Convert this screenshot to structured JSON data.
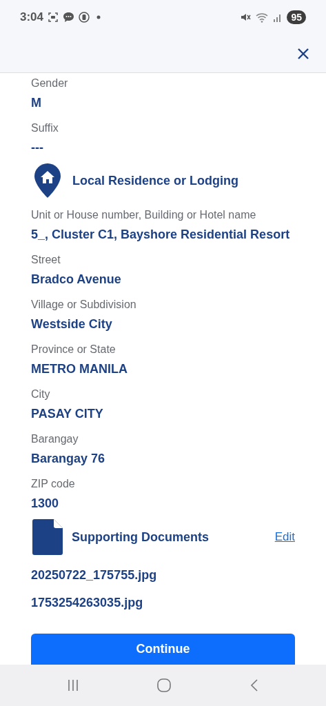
{
  "status_bar": {
    "time": "3:04",
    "battery": "95"
  },
  "personal_fields": [
    {
      "label": "Gender",
      "value": "M"
    },
    {
      "label": "Suffix",
      "value": "---"
    }
  ],
  "residence": {
    "title": "Local Residence or Lodging",
    "fields": [
      {
        "label": "Unit or House number, Building or Hotel name",
        "value": "5_, Cluster C1, Bayshore Residential Resort"
      },
      {
        "label": "Street",
        "value": "Bradco Avenue"
      },
      {
        "label": "Village or Subdivision",
        "value": "Westside City"
      },
      {
        "label": "Province or State",
        "value": "METRO MANILA"
      },
      {
        "label": "City",
        "value": "PASAY CITY"
      },
      {
        "label": "Barangay",
        "value": "Barangay 76"
      },
      {
        "label": "ZIP code",
        "value": "1300"
      }
    ]
  },
  "documents": {
    "title": "Supporting Documents",
    "action": "Edit",
    "files": [
      "20250722_175755.jpg",
      "1753254263035.jpg"
    ]
  },
  "continue_button": "Continue"
}
